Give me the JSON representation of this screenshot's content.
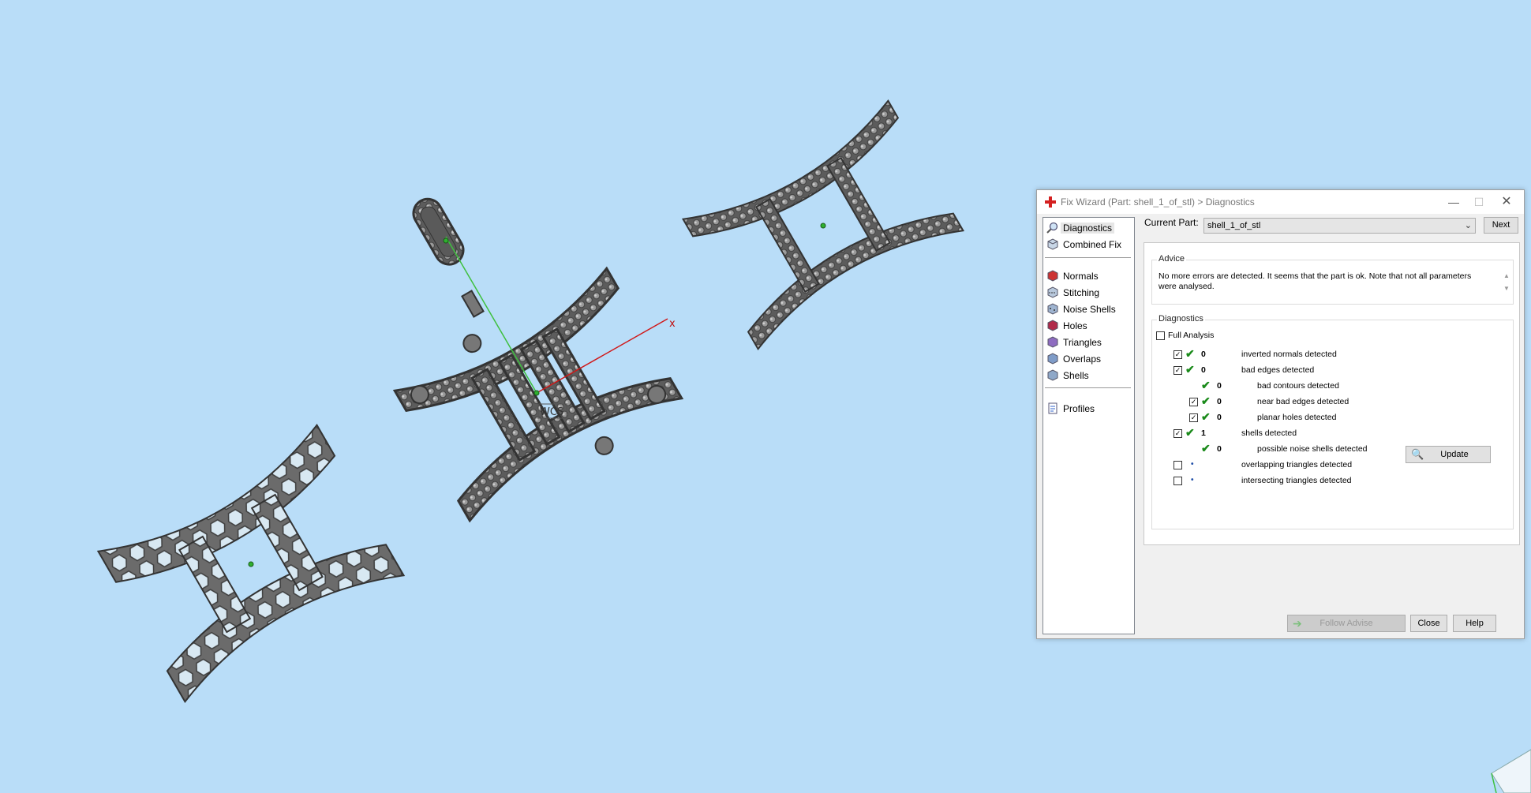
{
  "viewport": {
    "axis_x_label": "x",
    "annotation": "WCS",
    "background_color": "#b9ddf8",
    "part_color": "#6a6a6a"
  },
  "dialog": {
    "title": "Fix Wizard (Part: shell_1_of_stl) > Diagnostics",
    "title_icon": "red-cross-icon",
    "controls": {
      "minimize": "—",
      "maximize": "☐",
      "close": "✕"
    },
    "sidebar": {
      "top_items": [
        {
          "label": "Diagnostics",
          "icon": "magnifier-icon",
          "selected": true
        },
        {
          "label": "Combined Fix",
          "icon": "cube-icon"
        }
      ],
      "fix_items": [
        {
          "label": "Normals",
          "icon": "normals-icon"
        },
        {
          "label": "Stitching",
          "icon": "stitching-icon"
        },
        {
          "label": "Noise Shells",
          "icon": "noise-shells-icon"
        },
        {
          "label": "Holes",
          "icon": "holes-icon"
        },
        {
          "label": "Triangles",
          "icon": "triangles-icon"
        },
        {
          "label": "Overlaps",
          "icon": "overlaps-icon"
        },
        {
          "label": "Shells",
          "icon": "shells-icon"
        }
      ],
      "bottom_items": [
        {
          "label": "Profiles",
          "icon": "profiles-icon"
        }
      ]
    },
    "current_part": {
      "label": "Current Part:",
      "value": "shell_1_of_stl"
    },
    "next_label": "Next",
    "advice": {
      "title": "Advice",
      "text": "No more errors are detected. It seems that the part is ok. Note that not all parameters were analysed."
    },
    "diagnostics": {
      "title": "Diagnostics",
      "full_analysis_label": "Full Analysis",
      "full_analysis_checked": false,
      "rows": [
        {
          "checked": true,
          "status": "ok",
          "count": "0",
          "label": "inverted normals detected",
          "indent": 0
        },
        {
          "checked": true,
          "status": "ok",
          "count": "0",
          "label": "bad edges detected",
          "indent": 0
        },
        {
          "checked": null,
          "status": "ok",
          "count": "0",
          "label": "bad contours detected",
          "indent": 1
        },
        {
          "checked": true,
          "status": "ok",
          "count": "0",
          "label": "near bad edges detected",
          "indent": 1
        },
        {
          "checked": true,
          "status": "ok",
          "count": "0",
          "label": "planar holes detected",
          "indent": 1
        },
        {
          "checked": true,
          "status": "ok",
          "count": "1",
          "label": "shells detected",
          "indent": 0
        },
        {
          "checked": null,
          "status": "ok",
          "count": "0",
          "label": "possible noise shells detected",
          "indent": 1
        },
        {
          "checked": false,
          "status": "pending",
          "count": "•",
          "label": "overlapping triangles detected",
          "indent": 0
        },
        {
          "checked": false,
          "status": "pending",
          "count": "•",
          "label": "intersecting triangles detected",
          "indent": 0
        }
      ]
    },
    "update_label": "Update",
    "follow_advice_label": "Follow Advise",
    "close_label": "Close",
    "help_label": "Help",
    "check_color": "#1a8a1a"
  }
}
